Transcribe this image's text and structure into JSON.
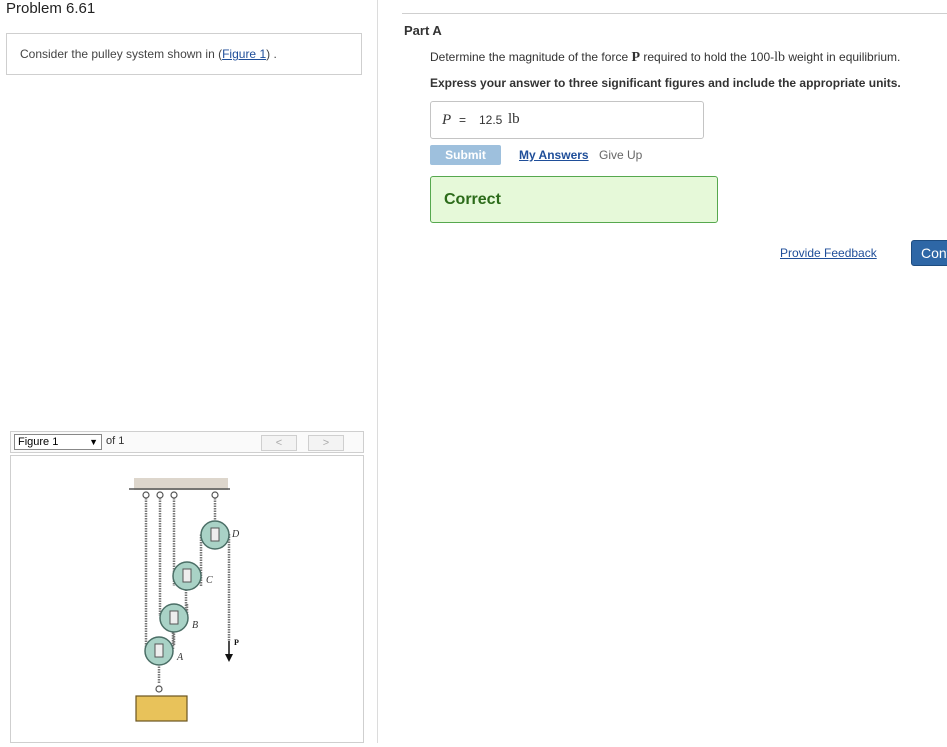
{
  "problem": {
    "title": "Problem 6.61",
    "intro_prefix": "Consider the pulley system shown in (",
    "intro_link": "Figure 1",
    "intro_suffix": ") ."
  },
  "figure_nav": {
    "selected": "Figure 1",
    "of_label": "of 1",
    "prev_label": "<",
    "next_label": ">"
  },
  "figure": {
    "labels": {
      "a": "A",
      "b": "B",
      "c": "C",
      "d": "D",
      "p": "P"
    }
  },
  "part": {
    "label": "Part A",
    "question_prefix": "Determine the magnitude of the force ",
    "question_symbol": "P",
    "question_middle": " required to hold the 100-",
    "question_unit": "lb",
    "question_suffix": " weight in equilibrium.",
    "instruction": "Express your answer to three significant figures and include the appropriate units."
  },
  "answer": {
    "variable": "P",
    "equals": "=",
    "value": "12.5",
    "unit": "lb"
  },
  "actions": {
    "submit": "Submit",
    "my_answers": "My Answers",
    "give_up": "Give Up"
  },
  "result": {
    "text": "Correct"
  },
  "footer": {
    "feedback": "Provide Feedback",
    "continue": "Continue"
  },
  "colors": {
    "link": "#1f4e99",
    "submit_disabled": "#9ec0dd",
    "correct_bg": "#e6f9d9",
    "correct_border": "#56a84e",
    "continue_bg": "#2e67a6",
    "pulley": "#a9d2c6",
    "weight": "#e8c25a"
  }
}
